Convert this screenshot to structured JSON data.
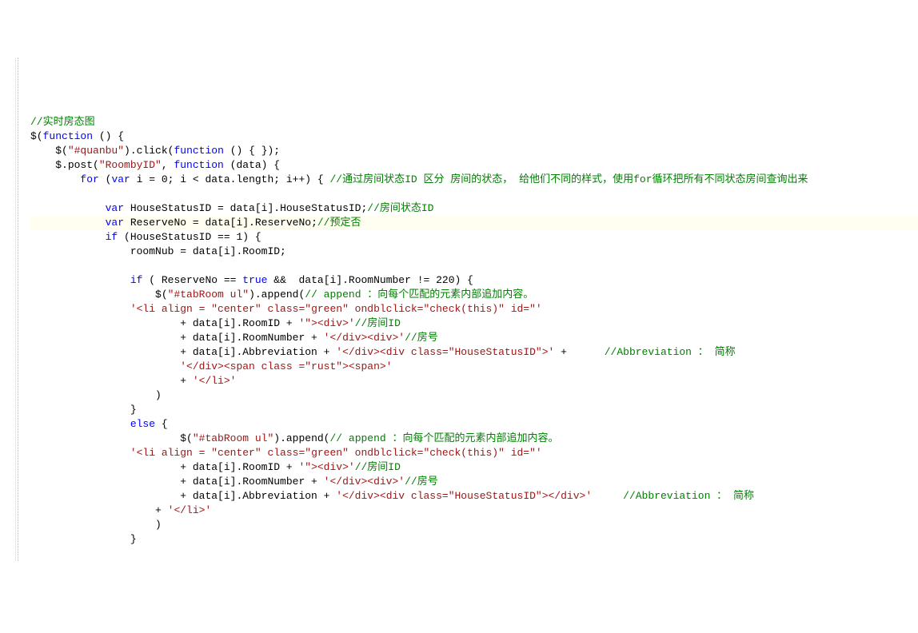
{
  "lines": [
    {
      "indent": 0,
      "tokens": [
        {
          "cls": "t-comment",
          "t": "//实时房态图"
        }
      ]
    },
    {
      "indent": 0,
      "tokens": [
        {
          "cls": "t-text",
          "t": "$("
        },
        {
          "cls": "t-keyword",
          "t": "function"
        },
        {
          "cls": "t-text",
          "t": " () {"
        }
      ]
    },
    {
      "indent": 1,
      "tokens": [
        {
          "cls": "t-text",
          "t": "$("
        },
        {
          "cls": "t-string",
          "t": "\"#quanbu\""
        },
        {
          "cls": "t-text",
          "t": ").click("
        },
        {
          "cls": "t-keyword",
          "t": "function"
        },
        {
          "cls": "t-text",
          "t": " () { });"
        }
      ]
    },
    {
      "indent": 1,
      "tokens": [
        {
          "cls": "t-text",
          "t": "$.post("
        },
        {
          "cls": "t-string",
          "t": "\"RoombyID\""
        },
        {
          "cls": "t-text",
          "t": ", "
        },
        {
          "cls": "t-keyword",
          "t": "function"
        },
        {
          "cls": "t-text",
          "t": " (data) {"
        }
      ]
    },
    {
      "indent": 2,
      "tokens": [
        {
          "cls": "t-keyword",
          "t": "for"
        },
        {
          "cls": "t-text",
          "t": " ("
        },
        {
          "cls": "t-keyword",
          "t": "var"
        },
        {
          "cls": "t-text",
          "t": " i = 0; i < data.length; i++) { "
        },
        {
          "cls": "t-comment",
          "t": "//通过房间状态ID 区分 房间的状态， 给他们不同的样式，使用for循环把所有不同状态房间查询出来"
        }
      ]
    },
    {
      "indent": 0,
      "tokens": []
    },
    {
      "indent": 3,
      "tokens": [
        {
          "cls": "t-keyword",
          "t": "var"
        },
        {
          "cls": "t-text",
          "t": " HouseStatusID = data[i].HouseStatusID;"
        },
        {
          "cls": "t-comment",
          "t": "//房间状态ID"
        }
      ]
    },
    {
      "indent": 3,
      "highlight": true,
      "tokens": [
        {
          "cls": "t-keyword",
          "t": "var"
        },
        {
          "cls": "t-text",
          "t": " ReserveNo = data[i].ReserveNo;"
        },
        {
          "cls": "t-comment",
          "t": "//预定否"
        }
      ]
    },
    {
      "indent": 3,
      "tokens": [
        {
          "cls": "t-keyword",
          "t": "if"
        },
        {
          "cls": "t-text",
          "t": " (HouseStatusID == 1) {"
        }
      ]
    },
    {
      "indent": 4,
      "tokens": [
        {
          "cls": "t-text",
          "t": "roomNub = data[i].RoomID;"
        }
      ]
    },
    {
      "indent": 0,
      "tokens": []
    },
    {
      "indent": 4,
      "tokens": [
        {
          "cls": "t-keyword",
          "t": "if"
        },
        {
          "cls": "t-text",
          "t": " ( ReserveNo == "
        },
        {
          "cls": "t-keyword",
          "t": "true"
        },
        {
          "cls": "t-text",
          "t": " &&  data[i].RoomNumber != 220) {"
        }
      ]
    },
    {
      "indent": 5,
      "tokens": [
        {
          "cls": "t-text",
          "t": "$("
        },
        {
          "cls": "t-string",
          "t": "\"#tabRoom ul\""
        },
        {
          "cls": "t-text",
          "t": ").append("
        },
        {
          "cls": "t-comment",
          "t": "// append ：向每个匹配的元素内部追加内容。"
        }
      ]
    },
    {
      "indent": 4,
      "tokens": [
        {
          "cls": "t-string",
          "t": "'<li align = \"center\" class=\"green\" ondblclick=\"check(this)\" id=\"'"
        }
      ]
    },
    {
      "indent": 6,
      "tokens": [
        {
          "cls": "t-text",
          "t": "+ data[i].RoomID + "
        },
        {
          "cls": "t-string",
          "t": "'\"><div>'"
        },
        {
          "cls": "t-comment",
          "t": "//房间ID"
        }
      ]
    },
    {
      "indent": 6,
      "tokens": [
        {
          "cls": "t-text",
          "t": "+ data[i].RoomNumber + "
        },
        {
          "cls": "t-string",
          "t": "'</div><div>'"
        },
        {
          "cls": "t-comment",
          "t": "//房号"
        }
      ]
    },
    {
      "indent": 6,
      "tokens": [
        {
          "cls": "t-text",
          "t": "+ data[i].Abbreviation + "
        },
        {
          "cls": "t-string",
          "t": "'</div><div class=\"HouseStatusID\">'"
        },
        {
          "cls": "t-text",
          "t": " +      "
        },
        {
          "cls": "t-comment",
          "t": "//Abbreviation ： 简称"
        }
      ]
    },
    {
      "indent": 6,
      "tokens": [
        {
          "cls": "t-string",
          "t": "'</div><span class =\"rust\"><span>'"
        }
      ]
    },
    {
      "indent": 6,
      "tokens": [
        {
          "cls": "t-text",
          "t": "+ "
        },
        {
          "cls": "t-string",
          "t": "'</li>'"
        }
      ]
    },
    {
      "indent": 5,
      "tokens": [
        {
          "cls": "t-text",
          "t": ")"
        }
      ]
    },
    {
      "indent": 4,
      "tokens": [
        {
          "cls": "t-text",
          "t": "}"
        }
      ]
    },
    {
      "indent": 4,
      "tokens": [
        {
          "cls": "t-keyword",
          "t": "else"
        },
        {
          "cls": "t-text",
          "t": " {"
        }
      ]
    },
    {
      "indent": 6,
      "tokens": [
        {
          "cls": "t-text",
          "t": "$("
        },
        {
          "cls": "t-string",
          "t": "\"#tabRoom ul\""
        },
        {
          "cls": "t-text",
          "t": ").append("
        },
        {
          "cls": "t-comment",
          "t": "// append ：向每个匹配的元素内部追加内容。"
        }
      ]
    },
    {
      "indent": 4,
      "tokens": [
        {
          "cls": "t-string",
          "t": "'<li align = \"center\" class=\"green\" ondblclick=\"check(this)\" id=\"'"
        }
      ]
    },
    {
      "indent": 6,
      "tokens": [
        {
          "cls": "t-text",
          "t": "+ data[i].RoomID + "
        },
        {
          "cls": "t-string",
          "t": "'\"><div>'"
        },
        {
          "cls": "t-comment",
          "t": "//房间ID"
        }
      ]
    },
    {
      "indent": 6,
      "tokens": [
        {
          "cls": "t-text",
          "t": "+ data[i].RoomNumber + "
        },
        {
          "cls": "t-string",
          "t": "'</div><div>'"
        },
        {
          "cls": "t-comment",
          "t": "//房号"
        }
      ]
    },
    {
      "indent": 6,
      "tokens": [
        {
          "cls": "t-text",
          "t": "+ data[i].Abbreviation + "
        },
        {
          "cls": "t-string",
          "t": "'</div><div class=\"HouseStatusID\"></div>'"
        },
        {
          "cls": "t-text",
          "t": "     "
        },
        {
          "cls": "t-comment",
          "t": "//Abbreviation ： 简称"
        }
      ]
    },
    {
      "indent": 5,
      "tokens": [
        {
          "cls": "t-text",
          "t": "+ "
        },
        {
          "cls": "t-string",
          "t": "'</li>'"
        }
      ]
    },
    {
      "indent": 5,
      "tokens": [
        {
          "cls": "t-text",
          "t": ")"
        }
      ]
    },
    {
      "indent": 4,
      "tokens": [
        {
          "cls": "t-text",
          "t": "}"
        }
      ]
    }
  ],
  "indent_unit": "    "
}
